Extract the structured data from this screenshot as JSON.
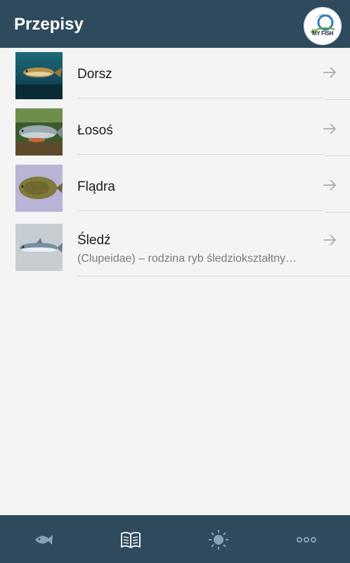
{
  "header": {
    "title": "Przepisy",
    "logo_text": "MY FISH"
  },
  "recipes": [
    {
      "name": "Dorsz",
      "description": "",
      "thumbnail_icon": "cod-photo"
    },
    {
      "name": "Łosoś",
      "description": "",
      "thumbnail_icon": "salmon-photo"
    },
    {
      "name": "Flądra",
      "description": "",
      "thumbnail_icon": "flounder-photo"
    },
    {
      "name": "Śledź",
      "description": "(Clupeidae) – rodzina ryb śledziokształtny…",
      "thumbnail_icon": "herring-photo"
    }
  ],
  "tabs": [
    {
      "icon": "fish-icon",
      "active": false
    },
    {
      "icon": "book-icon",
      "active": true
    },
    {
      "icon": "sun-icon",
      "active": false
    },
    {
      "icon": "more-icon",
      "active": false
    }
  ],
  "colors": {
    "bar_background": "#2e4a5c",
    "list_background": "#f4f4f4",
    "icon_inactive": "#8aa0b3",
    "icon_active": "#e9eff4"
  }
}
